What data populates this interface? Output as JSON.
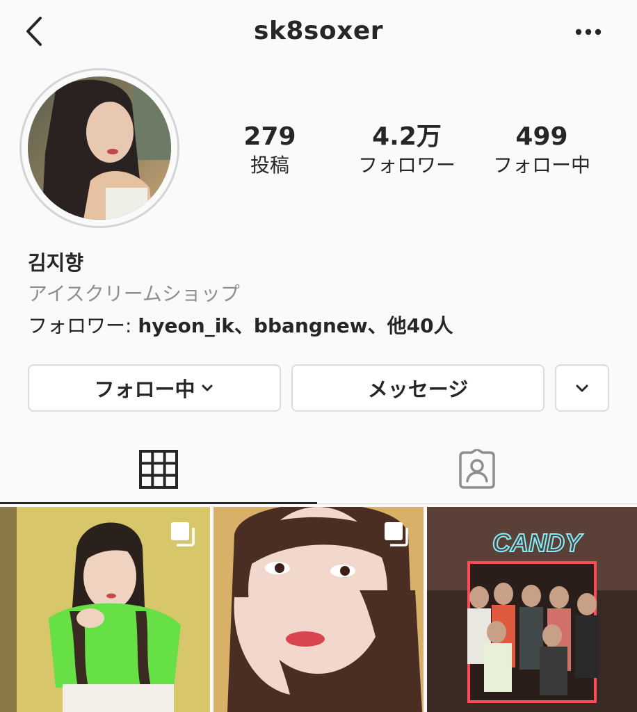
{
  "header": {
    "username": "sk8soxer",
    "back_icon": "chevron-left-icon",
    "more_icon": "more-horizontal-icon"
  },
  "profile": {
    "avatar": "profile-photo",
    "stats": [
      {
        "value": "279",
        "label": "投稿"
      },
      {
        "value": "4.2万",
        "label": "フォロワー"
      },
      {
        "value": "499",
        "label": "フォロー中"
      }
    ],
    "name": "김지향",
    "category": "アイスクリームショップ",
    "followed_by": {
      "prefix": "フォロワー: ",
      "users": "hyeon_ik、bbangnew、",
      "suffix": "他40人"
    }
  },
  "actions": {
    "following_label": "フォロー中",
    "message_label": "メッセージ",
    "suggest_icon": "chevron-down-icon"
  },
  "tabs": [
    {
      "name": "grid",
      "icon": "grid-icon",
      "active": true
    },
    {
      "name": "tagged",
      "icon": "tagged-person-icon",
      "active": false
    }
  ],
  "posts": [
    {
      "multi": true
    },
    {
      "multi": true
    },
    {
      "multi": false,
      "sign_text": "CANDY"
    }
  ]
}
